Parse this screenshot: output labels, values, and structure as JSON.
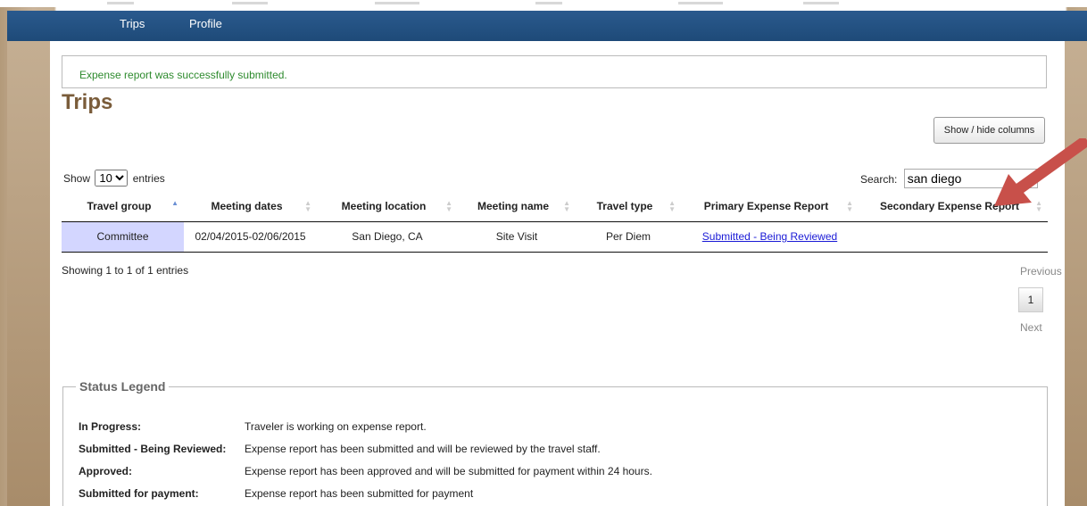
{
  "nav": {
    "trips": "Trips",
    "profile": "Profile"
  },
  "alert": "Expense report was successfully submitted.",
  "title": "Trips",
  "show_hide_columns": "Show / hide columns",
  "length": {
    "show": "Show",
    "value": "10",
    "entries": "entries"
  },
  "search": {
    "label": "Search:",
    "value": "san diego"
  },
  "columns": [
    "Travel group",
    "Meeting dates",
    "Meeting location",
    "Meeting name",
    "Travel type",
    "Primary Expense Report",
    "Secondary Expense Report"
  ],
  "rows": [
    {
      "group": "Committee",
      "dates": "02/04/2015-02/06/2015",
      "location": "San Diego, CA",
      "name": "Site Visit",
      "type": "Per Diem",
      "primary": "Submitted - Being Reviewed",
      "secondary": ""
    }
  ],
  "info": "Showing 1 to 1 of 1 entries",
  "pagination": {
    "previous": "Previous",
    "page": "1",
    "next": "Next"
  },
  "legend": {
    "title": "Status Legend",
    "items": [
      {
        "status": "In Progress:",
        "desc": "Traveler is working on expense report."
      },
      {
        "status": "Submitted - Being Reviewed:",
        "desc": "Expense report has been submitted and will be reviewed by the travel staff."
      },
      {
        "status": "Approved:",
        "desc": "Expense report has been approved and will be submitted for payment within 24 hours."
      },
      {
        "status": "Submitted for payment:",
        "desc": "Expense report has been submitted for payment"
      }
    ]
  },
  "colors": {
    "nav": "#1e4a78",
    "title": "#7a5c3a",
    "success": "#2e8b2e",
    "sorted": "#d3d6ff",
    "arrow": "#c8504a"
  }
}
